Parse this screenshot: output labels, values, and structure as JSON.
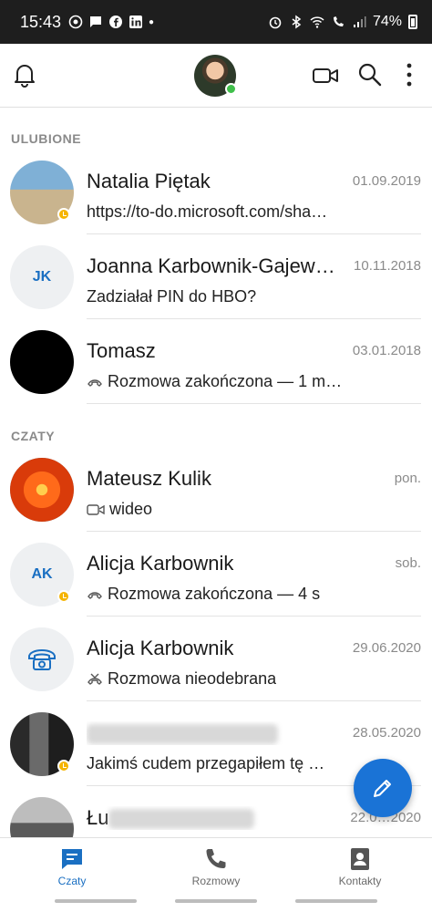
{
  "status_bar": {
    "time": "15:43",
    "battery": "74%"
  },
  "sections": {
    "favorites": "ULUBIONE",
    "chats": "CZATY"
  },
  "favorites": [
    {
      "name": "Natalia Piętak",
      "date": "01.09.2019",
      "preview": "https://to-do.microsoft.com/sha…",
      "icon": "none",
      "status": "away"
    },
    {
      "name": "Joanna Karbownik-Gajew…",
      "date": "10.11.2018",
      "preview": "Zadziałał PIN do HBO?",
      "initials": "JK",
      "icon": "none"
    },
    {
      "name": "Tomasz",
      "date": "03.01.2018",
      "preview": "Rozmowa zakończona — 1 m…",
      "icon": "call-ended-icon"
    }
  ],
  "chats": [
    {
      "name": "Mateusz Kulik",
      "date": "pon.",
      "preview": "wideo",
      "icon": "video-icon"
    },
    {
      "name": "Alicja Karbownik",
      "date": "sob.",
      "preview": "Rozmowa zakończona — 4 s",
      "initials": "AK",
      "icon": "call-ended-icon",
      "status": "away"
    },
    {
      "name": "Alicja Karbownik",
      "date": "29.06.2020",
      "preview": "Rozmowa nieodebrana",
      "icon": "missed-call-icon"
    },
    {
      "name": "",
      "date": "28.05.2020",
      "preview": "Jakimś cudem przegapiłem tę …",
      "icon": "none",
      "status": "away"
    },
    {
      "name": "Łu",
      "date": "22.0…2020",
      "preview": "",
      "icon": "none"
    }
  ],
  "bottom_nav": {
    "chats": "Czaty",
    "calls": "Rozmowy",
    "contacts": "Kontakty"
  },
  "colors": {
    "accent": "#1a73d6",
    "away": "#f5b400",
    "online": "#3fbf4a"
  }
}
